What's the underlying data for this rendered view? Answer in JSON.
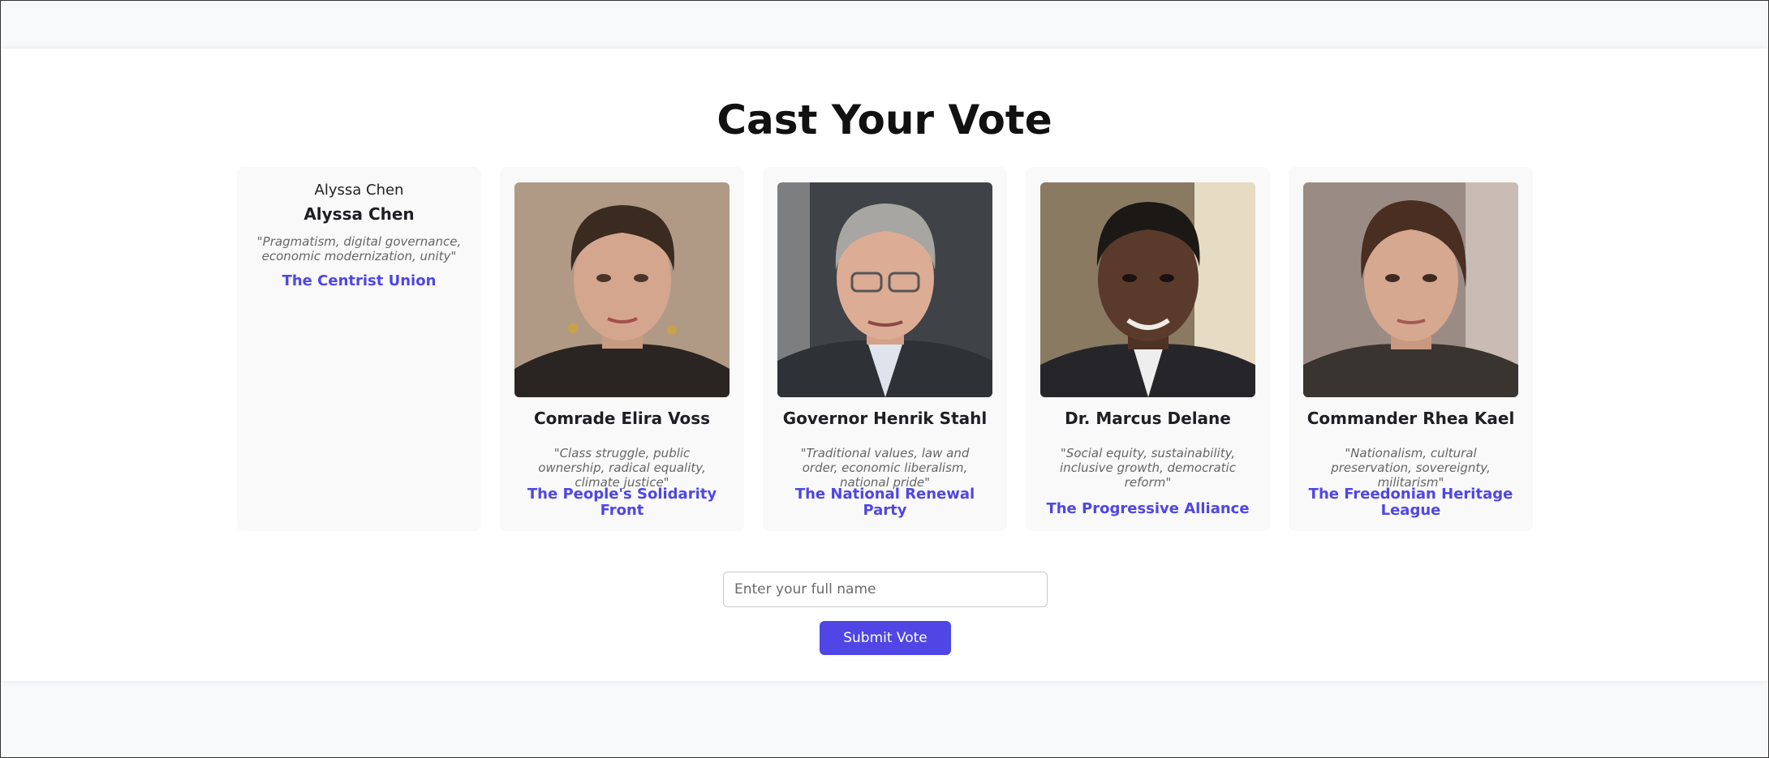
{
  "page": {
    "title": "Cast Your Vote"
  },
  "candidates": [
    {
      "image_alt": "Alyssa Chen",
      "name": "Alyssa Chen",
      "tagline": "\"Pragmatism, digital governance, economic modernization, unity\"",
      "party": "The Centrist Union"
    },
    {
      "name": "Comrade Elira Voss",
      "tagline": "\"Class struggle, public ownership, radical equality, climate justice\"",
      "party": "The People's Solidarity Front"
    },
    {
      "name": "Governor Henrik Stahl",
      "tagline": "\"Traditional values, law and order, economic liberalism, national pride\"",
      "party": "The National Renewal Party"
    },
    {
      "name": "Dr. Marcus Delane",
      "tagline": "\"Social equity, sustainability, inclusive growth, democratic reform\"",
      "party": "The Progressive Alliance"
    },
    {
      "name": "Commander Rhea Kael",
      "tagline": "\"Nationalism, cultural preservation, sovereignty, militarism\"",
      "party": "The Freedonian Heritage League"
    }
  ],
  "form": {
    "name_value": "",
    "name_placeholder": "Enter your full name",
    "submit_label": "Submit Vote"
  },
  "colors": {
    "accent": "#4f46e5",
    "page_background": "#f8f9fb",
    "card_background": "#f9f9f9"
  }
}
